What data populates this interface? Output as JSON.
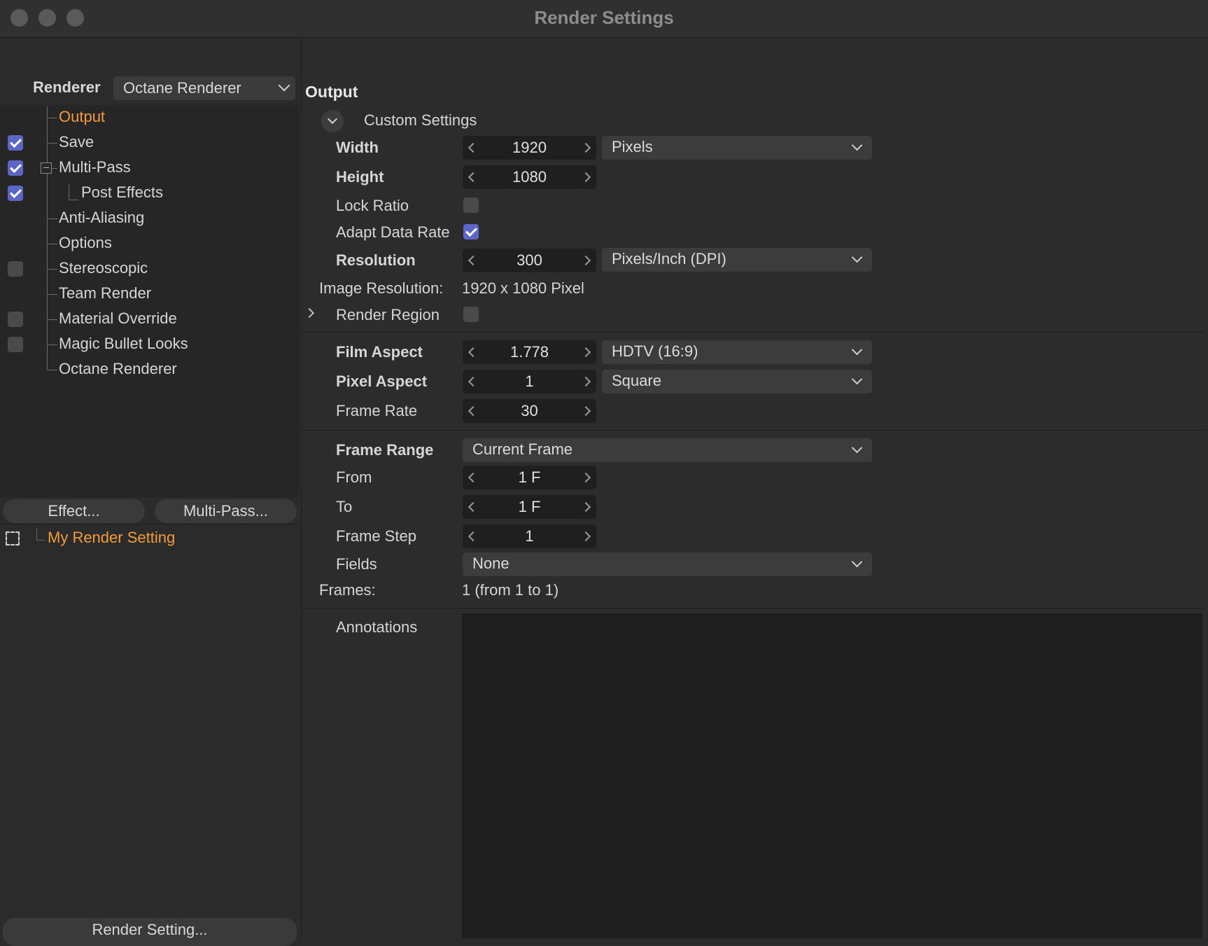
{
  "window": {
    "title": "Render Settings"
  },
  "sidebar": {
    "renderer_label": "Renderer",
    "renderer_value": "Octane Renderer",
    "items": [
      {
        "label": "Output",
        "checkbox": null,
        "active": true
      },
      {
        "label": "Save",
        "checkbox": true
      },
      {
        "label": "Multi-Pass",
        "checkbox": true
      },
      {
        "label": "Post Effects",
        "checkbox": true
      },
      {
        "label": "Anti-Aliasing",
        "checkbox": null
      },
      {
        "label": "Options",
        "checkbox": null
      },
      {
        "label": "Stereoscopic",
        "checkbox": false
      },
      {
        "label": "Team Render",
        "checkbox": null
      },
      {
        "label": "Material Override",
        "checkbox": false
      },
      {
        "label": "Magic Bullet Looks",
        "checkbox": false
      },
      {
        "label": "Octane Renderer",
        "checkbox": null
      }
    ],
    "effect_button": "Effect...",
    "multipass_button": "Multi-Pass...",
    "preset_name": "My Render Setting",
    "render_setting_button": "Render Setting..."
  },
  "output": {
    "section_title": "Output",
    "custom_settings": "Custom Settings",
    "width": {
      "label": "Width",
      "value": "1920",
      "unit": "Pixels"
    },
    "height": {
      "label": "Height",
      "value": "1080"
    },
    "lock_ratio": {
      "label": "Lock Ratio",
      "checked": false
    },
    "adapt_data_rate": {
      "label": "Adapt Data Rate",
      "checked": true
    },
    "resolution": {
      "label": "Resolution",
      "value": "300",
      "unit": "Pixels/Inch (DPI)"
    },
    "image_resolution": {
      "label": "Image Resolution:",
      "value": "1920 x 1080 Pixel"
    },
    "render_region": {
      "label": "Render Region",
      "checked": false
    },
    "film_aspect": {
      "label": "Film Aspect",
      "value": "1.778",
      "preset": "HDTV (16:9)"
    },
    "pixel_aspect": {
      "label": "Pixel Aspect",
      "value": "1",
      "preset": "Square"
    },
    "frame_rate": {
      "label": "Frame Rate",
      "value": "30"
    },
    "frame_range": {
      "label": "Frame Range",
      "value": "Current Frame"
    },
    "from": {
      "label": "From",
      "value": "1 F"
    },
    "to": {
      "label": "To",
      "value": "1 F"
    },
    "frame_step": {
      "label": "Frame Step",
      "value": "1"
    },
    "fields": {
      "label": "Fields",
      "value": "None"
    },
    "frames": {
      "label": "Frames:",
      "value": "1 (from 1 to 1)"
    },
    "annotations": {
      "label": "Annotations",
      "value": ""
    }
  },
  "colors": {
    "accent": "#f39a3c",
    "checkbox": "#5c66c6"
  }
}
